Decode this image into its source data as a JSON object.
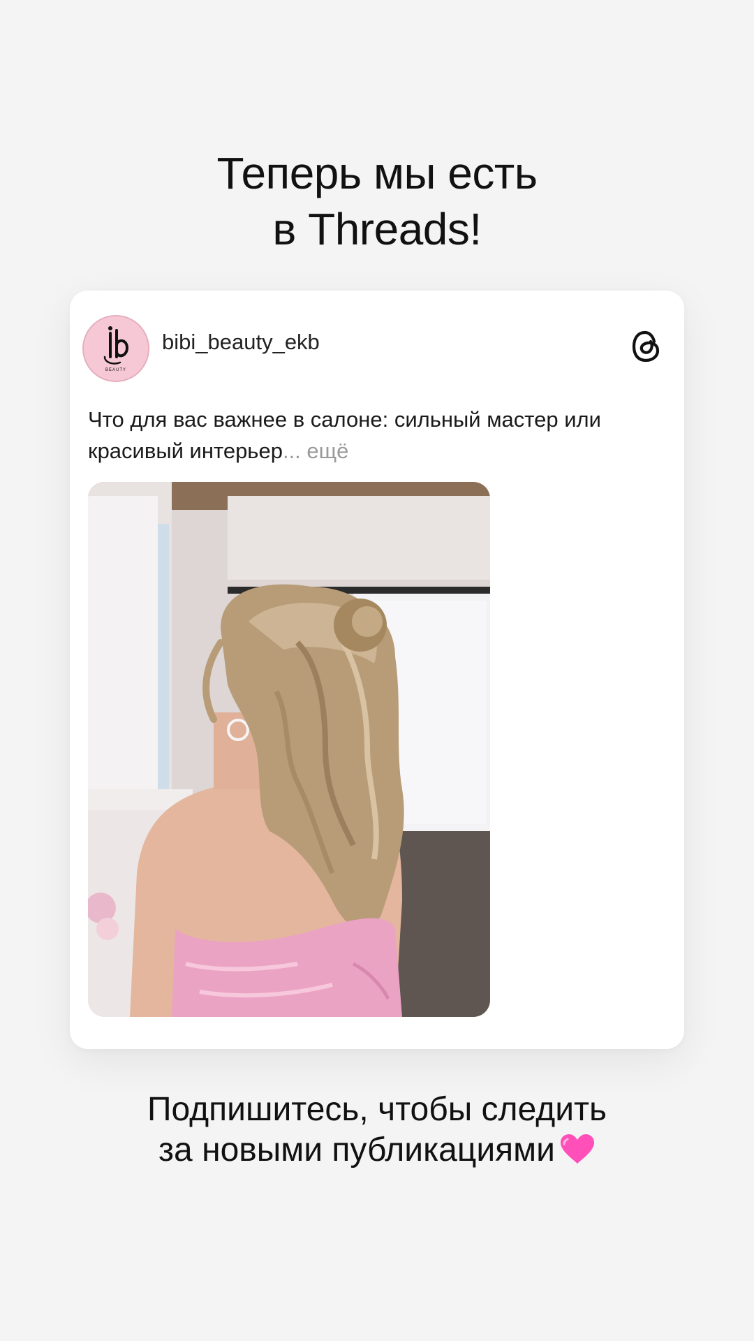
{
  "headline": {
    "line1": "Теперь мы есть",
    "line2_prefix": "в",
    "line2_brand": "Threads!"
  },
  "post": {
    "avatar": {
      "logo_letters": "ib",
      "logo_caption": "BEAUTY"
    },
    "username": "bibi_beauty_ekb",
    "text": "Что для вас важнее в салоне: сильный мастер или красивый интерьер",
    "more_label": "... ещё",
    "threads_icon": "threads-logo-icon"
  },
  "cta": {
    "line1": "Подпишитесь, чтобы следить",
    "line2": "за новыми публикациями",
    "emoji_icon": "pink-heart-icon"
  },
  "colors": {
    "background": "#f4f4f4",
    "card": "#ffffff",
    "avatar_bg": "#f6c8d6",
    "more_text": "#9a9a9a",
    "heart": "#ff4fb8"
  }
}
